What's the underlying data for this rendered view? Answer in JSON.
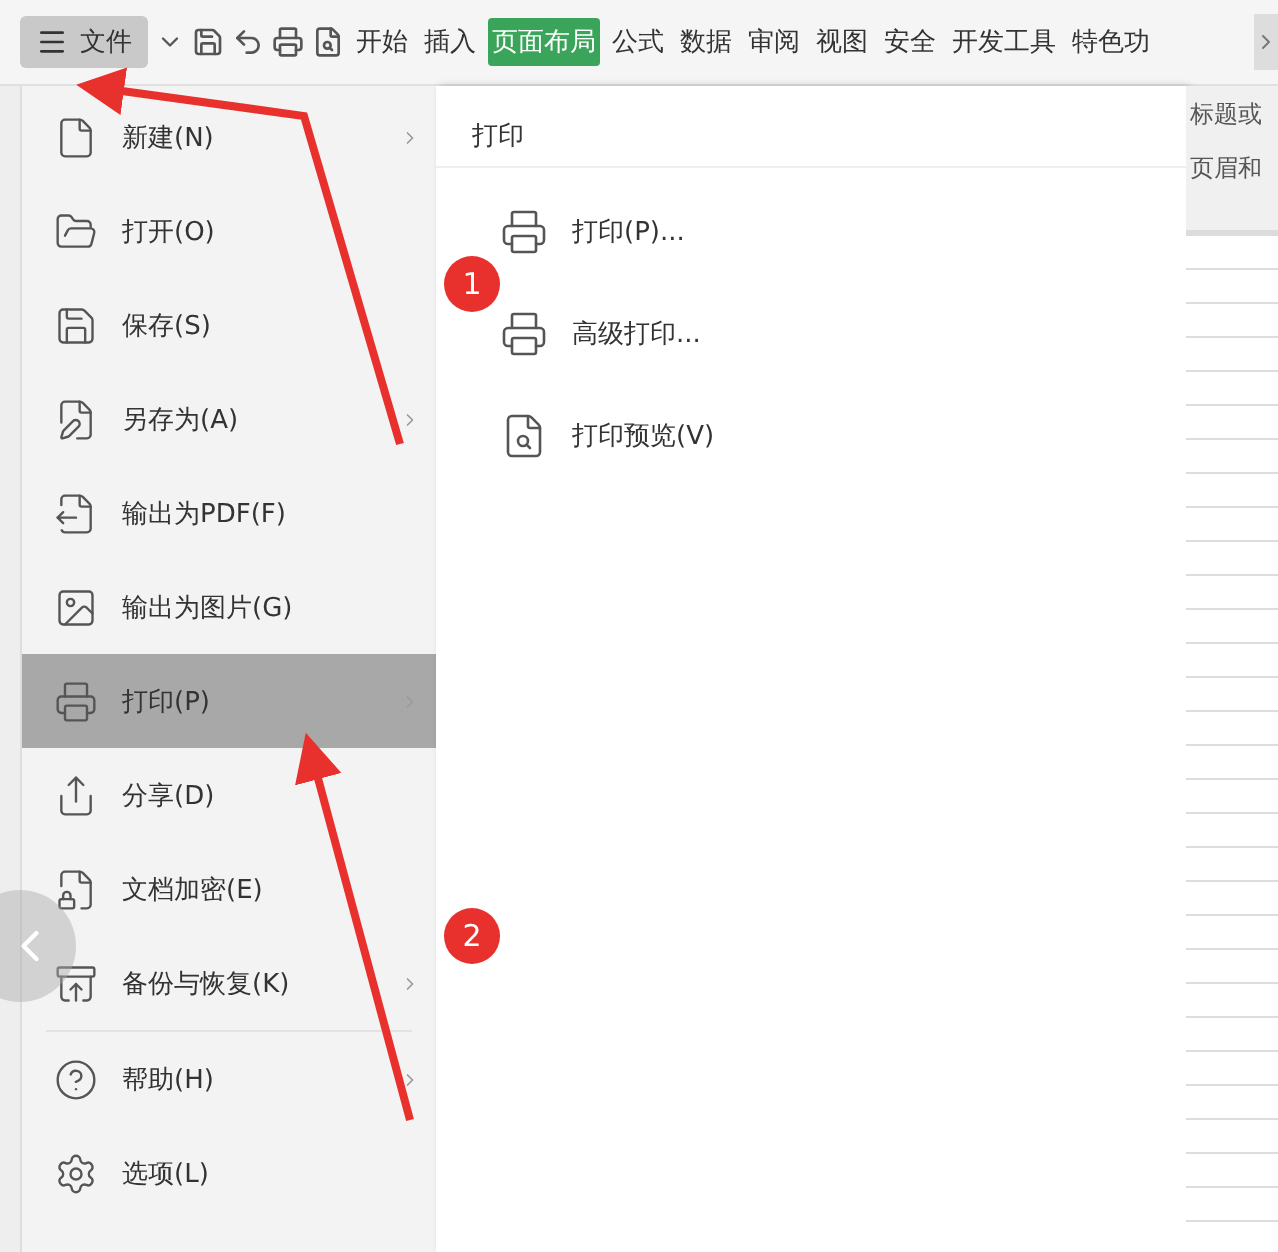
{
  "toolbar": {
    "file_button": {
      "label": "文件"
    },
    "tabs": [
      {
        "label": "开始",
        "selected": false
      },
      {
        "label": "插入",
        "selected": false
      },
      {
        "label": "页面布局",
        "selected": true
      },
      {
        "label": "公式",
        "selected": false
      },
      {
        "label": "数据",
        "selected": false
      },
      {
        "label": "审阅",
        "selected": false
      },
      {
        "label": "视图",
        "selected": false
      },
      {
        "label": "安全",
        "selected": false
      },
      {
        "label": "开发工具",
        "selected": false
      },
      {
        "label": "特色功",
        "selected": false
      }
    ]
  },
  "file_menu": {
    "items": [
      {
        "label": "新建(N)",
        "has_submenu": true,
        "selected": false
      },
      {
        "label": "打开(O)",
        "has_submenu": false,
        "selected": false
      },
      {
        "label": "保存(S)",
        "has_submenu": false,
        "selected": false
      },
      {
        "label": "另存为(A)",
        "has_submenu": true,
        "selected": false
      },
      {
        "label": "输出为PDF(F)",
        "has_submenu": false,
        "selected": false
      },
      {
        "label": "输出为图片(G)",
        "has_submenu": false,
        "selected": false
      },
      {
        "label": "打印(P)",
        "has_submenu": true,
        "selected": true
      },
      {
        "label": "分享(D)",
        "has_submenu": false,
        "selected": false
      },
      {
        "label": "文档加密(E)",
        "has_submenu": false,
        "selected": false
      },
      {
        "label": "备份与恢复(K)",
        "has_submenu": true,
        "selected": false
      },
      {
        "label": "帮助(H)",
        "has_submenu": true,
        "selected": false
      },
      {
        "label": "选项(L)",
        "has_submenu": false,
        "selected": false
      }
    ]
  },
  "submenu": {
    "title": "打印",
    "items": [
      {
        "label": "打印(P)..."
      },
      {
        "label": "高级打印..."
      },
      {
        "label": "打印预览(V)"
      }
    ]
  },
  "ribbon_behind": [
    "标题或",
    "页眉和"
  ],
  "annotations": [
    {
      "label": "1"
    },
    {
      "label": "2"
    }
  ]
}
